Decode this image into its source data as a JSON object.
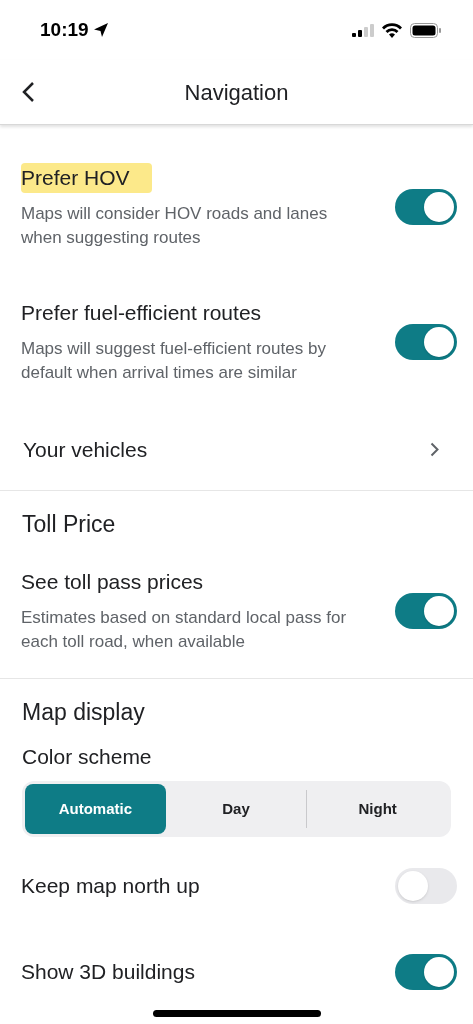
{
  "status_bar": {
    "time": "10:19"
  },
  "header": {
    "title": "Navigation"
  },
  "sections": [
    {
      "items": [
        {
          "kind": "toggle",
          "title": "Prefer HOV",
          "highlighted": true,
          "description": "Maps will consider HOV roads and lanes when suggesting routes",
          "on": true
        },
        {
          "kind": "toggle",
          "title": "Prefer fuel-efficient routes",
          "highlighted": false,
          "description": "Maps will suggest fuel-efficient routes by default when arrival times are similar",
          "on": true
        },
        {
          "kind": "link",
          "title": "Your vehicles"
        }
      ]
    },
    {
      "heading": "Toll Price",
      "items": [
        {
          "kind": "toggle",
          "title": "See toll pass prices",
          "highlighted": false,
          "description": "Estimates based on standard local pass for each toll road, when available",
          "on": true
        }
      ]
    },
    {
      "heading": "Map display",
      "items": [
        {
          "kind": "segmented",
          "title": "Color scheme",
          "options": [
            {
              "label": "Automatic",
              "selected": true
            },
            {
              "label": "Day",
              "selected": false
            },
            {
              "label": "Night",
              "selected": false
            }
          ]
        },
        {
          "kind": "toggle",
          "title": "Keep map north up",
          "highlighted": false,
          "on": false
        },
        {
          "kind": "toggle",
          "title": "Show 3D buildings",
          "highlighted": false,
          "on": true
        }
      ]
    }
  ]
}
